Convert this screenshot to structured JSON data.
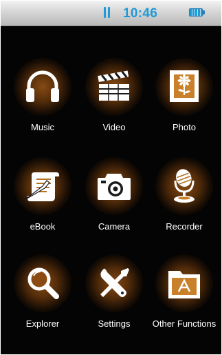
{
  "status_bar": {
    "playback_icon": "pause-icon",
    "time": "10:46",
    "battery_icon": "battery-icon",
    "battery_level": 1.0,
    "accent_color": "#1e9ad6"
  },
  "menu": {
    "glow_color": "#8c4e14",
    "items": [
      {
        "label": "Music",
        "icon": "headphones-icon"
      },
      {
        "label": "Video",
        "icon": "clapperboard-icon"
      },
      {
        "label": "Photo",
        "icon": "picture-frame-icon"
      },
      {
        "label": "eBook",
        "icon": "scroll-quill-icon"
      },
      {
        "label": "Camera",
        "icon": "camera-icon"
      },
      {
        "label": "Recorder",
        "icon": "microphone-icon"
      },
      {
        "label": "Explorer",
        "icon": "magnifier-icon"
      },
      {
        "label": "Settings",
        "icon": "wrench-screwdriver-icon"
      },
      {
        "label": "Other Functions",
        "icon": "folder-icon"
      }
    ]
  }
}
